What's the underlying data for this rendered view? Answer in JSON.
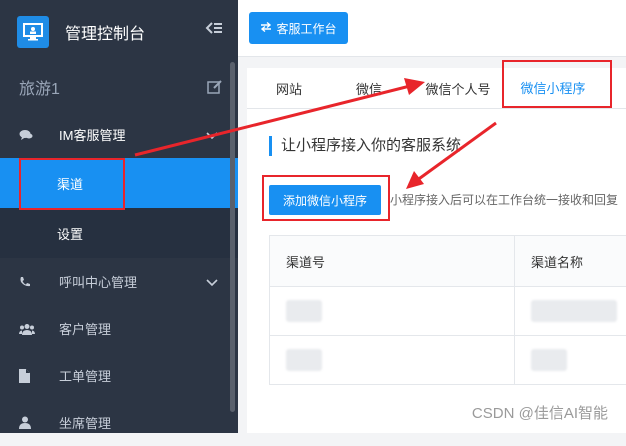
{
  "sidebar": {
    "brand_title": "管理控制台",
    "tenant": "旅游1",
    "groups": [
      {
        "label": "IM客服管理"
      },
      {
        "label": "呼叫中心管理"
      },
      {
        "label": "客户管理"
      },
      {
        "label": "工单管理"
      },
      {
        "label": "坐席管理"
      }
    ],
    "sub_items": [
      {
        "label": "渠道"
      },
      {
        "label": "设置"
      }
    ]
  },
  "topbar": {
    "workbench_label": "客服工作台"
  },
  "tabs": [
    {
      "label": "网站"
    },
    {
      "label": "微信"
    },
    {
      "label": "微信个人号"
    },
    {
      "label": "微信小程序"
    }
  ],
  "main": {
    "section_title": "让小程序接入你的客服系统",
    "add_button": "添加微信小程序",
    "hint": "小程序接入后可以在工作台统一接收和回复",
    "table": {
      "headers": [
        "渠道号",
        "渠道名称"
      ]
    }
  },
  "watermark": "CSDN @佳信AI智能",
  "colors": {
    "accent": "#1890f2",
    "sidebar": "#2c3544",
    "annotation": "#e8252b"
  }
}
